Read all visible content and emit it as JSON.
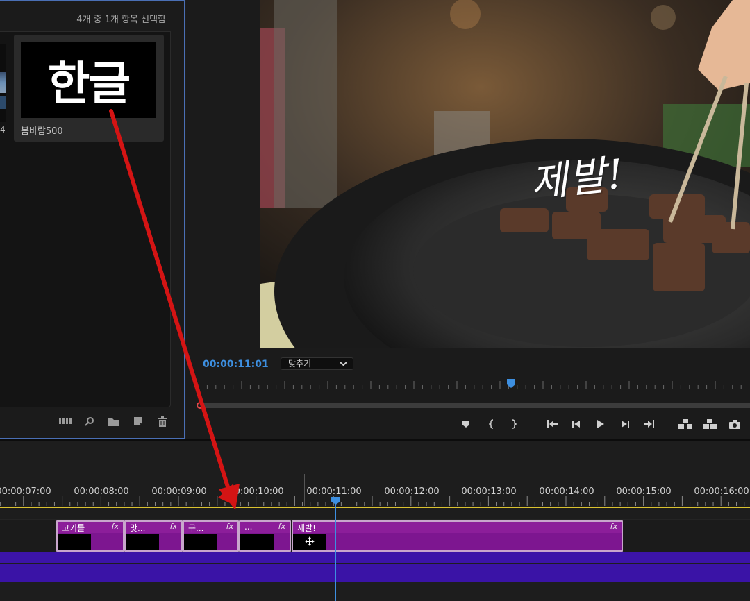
{
  "project_panel": {
    "selection_status": "4개 중 1개 항목 선택함",
    "partial_item_number": "4",
    "item": {
      "thumbnail_text": "한글",
      "name": "봄바람500"
    },
    "toolbar_icons": [
      "freeform-view-icon",
      "search-icon",
      "new-bin-icon",
      "new-item-icon",
      "trash-icon"
    ]
  },
  "program_monitor": {
    "overlay_title": "제발!",
    "timecode": "00:00:11:01",
    "zoom_label": "맞추기",
    "transport_icons": [
      "add-marker-icon",
      "mark-in-icon",
      "mark-out-icon",
      "go-to-in-icon",
      "step-back-icon",
      "play-icon",
      "step-forward-icon",
      "go-to-out-icon",
      "lift-icon",
      "extract-icon",
      "export-frame-icon"
    ]
  },
  "timeline": {
    "ruler_labels": [
      "00:00:07:00",
      "00:00:08:00",
      "00:00:09:00",
      "00:00:10:00",
      "00:00:11:00",
      "00:00:12:00",
      "00:00:13:00",
      "00:00:14:00",
      "00:00:15:00",
      "00:00:16:00"
    ],
    "clips": [
      {
        "label": "고기를",
        "fx": "fx"
      },
      {
        "label": "맛...",
        "fx": "fx"
      },
      {
        "label": "구...",
        "fx": "fx"
      },
      {
        "label": "...",
        "fx": "fx"
      },
      {
        "label": "제발!",
        "fx": "fx"
      }
    ]
  },
  "colors": {
    "accent_blue": "#3d8fe0",
    "clip_purple": "#7a1f86",
    "audio_track": "#3c14a8",
    "work_area_yellow": "#d9c12f",
    "annotation_red": "#d41414"
  }
}
